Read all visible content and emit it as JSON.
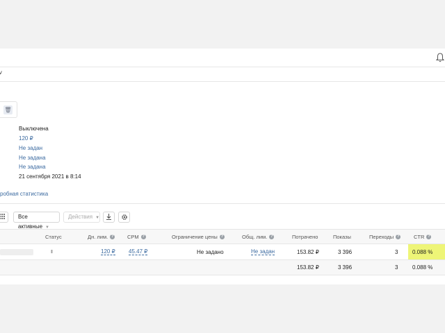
{
  "header": {
    "bell_icon": "bell-icon"
  },
  "tabrow": {
    "chevron": "˅"
  },
  "details": {
    "status": "Выключена",
    "daily_limit": "120 ₽",
    "cpm": "Не задан",
    "price_limit": "Не задана",
    "total_limit": "Не задана",
    "created": "21 сентября 2021 в 8:14"
  },
  "stats_link": "робная статистика",
  "toolbar": {
    "filter_label": "Все активные",
    "actions_label": "Действия"
  },
  "table": {
    "headers": {
      "status": "Статус",
      "daily_limit": "Дн. лим.",
      "cpm": "CPM",
      "price_limit": "Ограничение цены",
      "total_limit": "Общ. лим.",
      "spent": "Потрачено",
      "impressions": "Показы",
      "clicks": "Переходы",
      "ctr": "CTR"
    },
    "row": {
      "status_icon": "II",
      "daily_limit": "120 ₽",
      "cpm": "45.47 ₽",
      "price_limit": "Не задано",
      "total_limit": "Не задан",
      "spent": "153.82 ₽",
      "impressions": "3 396",
      "clicks": "3",
      "ctr": "0.088 %"
    },
    "totals": {
      "spent": "153.82 ₽",
      "impressions": "3 396",
      "clicks": "3",
      "ctr": "0.088 %"
    }
  },
  "colors": {
    "link": "#3b6aa0",
    "ctr_highlight": "#eef577"
  }
}
